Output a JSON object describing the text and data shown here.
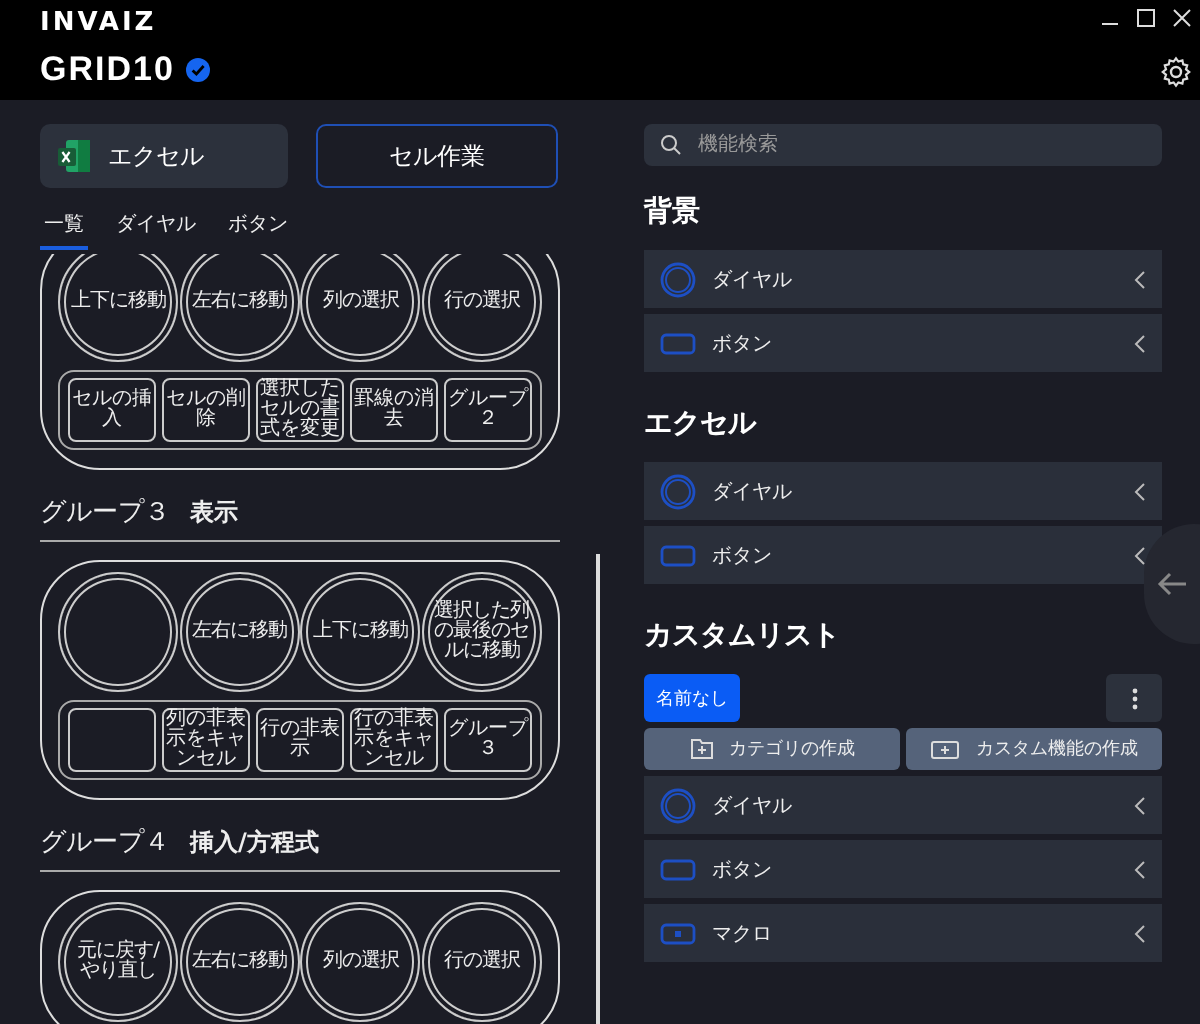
{
  "brand": "INVAIZ",
  "product": "GRID10",
  "verified": true,
  "profile": {
    "app": "エクセル",
    "preset": "セル作業"
  },
  "tabs": [
    {
      "label": "一覧",
      "selected": true
    },
    {
      "label": "ダイヤル",
      "selected": false
    },
    {
      "label": "ボタン",
      "selected": false
    }
  ],
  "groups": [
    {
      "dials": [
        {
          "label": "上下に移動"
        },
        {
          "label": "左右に移動"
        },
        {
          "label": "列の選択"
        },
        {
          "label": "行の選択"
        }
      ],
      "buttons": [
        {
          "label": "セルの挿入"
        },
        {
          "label": "セルの削除"
        },
        {
          "label": "選択したセルの書式を変更"
        },
        {
          "label": "罫線の消去"
        },
        {
          "label": "グループ２"
        }
      ]
    },
    {
      "name": "グループ３",
      "subtitle": "表示",
      "dials": [
        {
          "kind": "blank"
        },
        {
          "label": "左右に移動"
        },
        {
          "label": "上下に移動"
        },
        {
          "label": "選択した列の最後のセルに移動"
        }
      ],
      "buttons": [
        {
          "kind": "blank"
        },
        {
          "label": "列の非表示をキャンセル"
        },
        {
          "label": "行の非表示"
        },
        {
          "label": "行の非表示をキャンセル"
        },
        {
          "label": "グループ３"
        }
      ]
    },
    {
      "name": "グループ４",
      "subtitle": "挿入/方程式",
      "dials": [
        {
          "label": "元に戻す/やり直し"
        },
        {
          "label": "左右に移動"
        },
        {
          "label": "列の選択"
        },
        {
          "label": "行の選択"
        }
      ]
    }
  ],
  "search": {
    "placeholder": "機能検索"
  },
  "sections": [
    {
      "title": "背景",
      "items": [
        {
          "kind": "dial",
          "label": "ダイヤル"
        },
        {
          "kind": "button",
          "label": "ボタン"
        }
      ]
    },
    {
      "title": "エクセル",
      "items": [
        {
          "kind": "dial",
          "label": "ダイヤル"
        },
        {
          "kind": "button",
          "label": "ボタン"
        }
      ]
    }
  ],
  "custom_list": {
    "title": "カスタムリスト",
    "chip": "名前なし",
    "actions": [
      "カテゴリの作成",
      "カスタム機能の作成"
    ],
    "items": [
      {
        "kind": "dial",
        "label": "ダイヤル"
      },
      {
        "kind": "button",
        "label": "ボタン"
      },
      {
        "kind": "macro",
        "label": "マクロ"
      }
    ]
  }
}
